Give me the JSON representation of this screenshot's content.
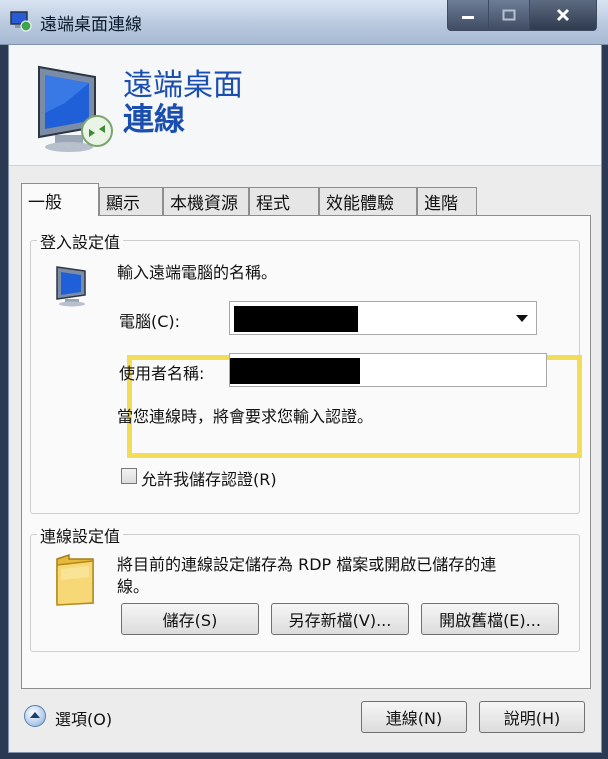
{
  "window": {
    "title": "遠端桌面連線"
  },
  "banner": {
    "line1": "遠端桌面",
    "line2": "連線"
  },
  "tabs": [
    "一般",
    "顯示",
    "本機資源",
    "程式",
    "效能體驗",
    "進階"
  ],
  "login": {
    "group_title": "登入設定值",
    "prompt": "輸入遠端電腦的名稱。",
    "computer_label": "電腦(C):",
    "computer_value": "",
    "username_label": "使用者名稱:",
    "username_value": "",
    "credentials_note": "當您連線時，將會要求您輸入認證。",
    "save_credentials_label": "允許我儲存認證(R)",
    "save_credentials_checked": false
  },
  "connection": {
    "group_title": "連線設定值",
    "description_line1": "將目前的連線設定儲存為 RDP 檔案或開啟已儲存的連",
    "description_line2": "線。",
    "save_label": "儲存(S)",
    "save_as_label": "另存新檔(V)...",
    "open_label": "開啟舊檔(E)..."
  },
  "footer": {
    "options_label": "選項(O)",
    "connect_label": "連線(N)",
    "help_label": "說明(H)"
  },
  "colors": {
    "highlight": "#f3dc58",
    "banner_title": "#1a4fb0",
    "title_bar": "#c3d1e4"
  }
}
